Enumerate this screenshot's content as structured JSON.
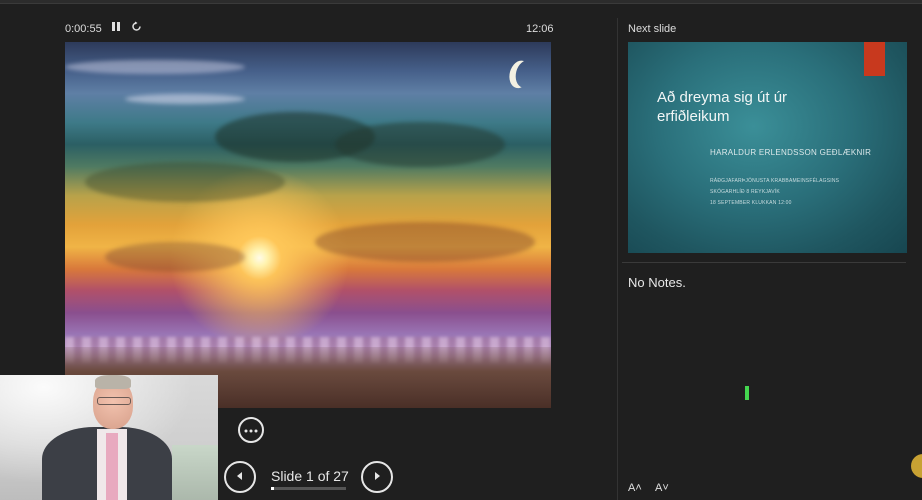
{
  "header": {
    "elapsed_time": "0:00:55",
    "pause_icon": "pause-icon",
    "restart_icon": "restart-icon",
    "clock": "12:06"
  },
  "main_slide": {
    "image_icon": "sunset-landscape-image"
  },
  "controls": {
    "more_icon": "more-options-icon",
    "prev_icon": "previous-slide-icon",
    "next_icon": "next-slide-icon",
    "slide_indicator": "Slide 1 of 27",
    "progress_fraction": 0.037
  },
  "next_panel": {
    "label": "Next slide",
    "title": "Að dreyma sig út úr erfiðleikum",
    "author": "HARALDUR ERLENDSSON GEÐLÆKNIR",
    "lines": [
      "RÁÐGJAFARÞJÓNUSTA KRABBAMEINSFÉLAGSINS",
      "SKÓGARHLÍÐ 8 REYKJAVÍK",
      "18 SEPTEMBER KLUKKAN 12:00"
    ],
    "accent_color": "#c8391e"
  },
  "notes": {
    "text": "No Notes."
  },
  "font_controls": {
    "increase_label": "A˄",
    "decrease_label": "A˅"
  }
}
